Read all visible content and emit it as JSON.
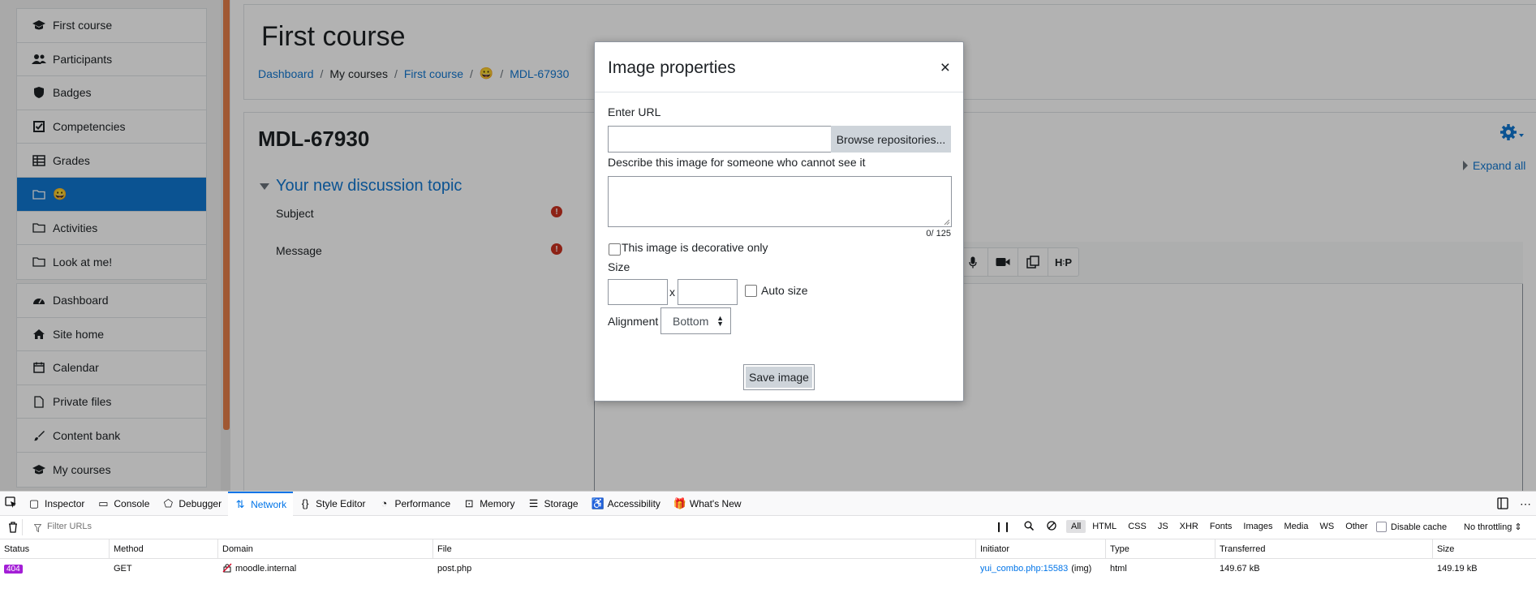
{
  "sidebar": {
    "group1": [
      {
        "label": "First course",
        "icon": "graduation-cap-icon"
      },
      {
        "label": "Participants",
        "icon": "users-icon"
      },
      {
        "label": "Badges",
        "icon": "shield-icon"
      },
      {
        "label": "Competencies",
        "icon": "check-square-icon"
      },
      {
        "label": "Grades",
        "icon": "table-icon"
      },
      {
        "label": "😀",
        "icon": "folder-icon",
        "active": true
      },
      {
        "label": "Activities",
        "icon": "folder-icon"
      },
      {
        "label": "Look at me!",
        "icon": "folder-icon"
      }
    ],
    "group2": [
      {
        "label": "Dashboard",
        "icon": "tachometer-icon"
      },
      {
        "label": "Site home",
        "icon": "home-icon"
      },
      {
        "label": "Calendar",
        "icon": "calendar-icon"
      },
      {
        "label": "Private files",
        "icon": "file-icon"
      },
      {
        "label": "Content bank",
        "icon": "paintbrush-icon"
      },
      {
        "label": "My courses",
        "icon": "graduation-cap-icon"
      }
    ]
  },
  "header": {
    "title": "First course",
    "breadcrumb": [
      "Dashboard",
      "My courses",
      "First course",
      "😀",
      "MDL-67930"
    ]
  },
  "main": {
    "forum_title": "MDL-67930",
    "topic_header": "Your new discussion topic",
    "subject_label": "Subject",
    "message_label": "Message",
    "expand_all": "Expand all",
    "required_glyph": "!",
    "toolbar_buttons": [
      {
        "icon": "microphone-icon",
        "glyph": "🎤"
      },
      {
        "icon": "video-icon",
        "glyph": "🎥"
      },
      {
        "icon": "copy-icon",
        "glyph": "⧉"
      },
      {
        "icon": "h5p-icon",
        "glyph": "H‑P"
      }
    ]
  },
  "dialog": {
    "title": "Image properties",
    "close": "×",
    "url_label": "Enter URL",
    "url_value": "",
    "browse_button": "Browse repositories...",
    "alt_label": "Describe this image for someone who cannot see it",
    "char_count": "0/ 125",
    "decorative_label": "This image is decorative only",
    "size_label": "Size",
    "size_x": "x",
    "autosize_label": "Auto size",
    "alignment_label": "Alignment",
    "alignment_value": "Bottom",
    "save_button": "Save image"
  },
  "devtools": {
    "tabs": [
      {
        "label": "Inspector",
        "icon": "inspector-icon",
        "glyph": "▢"
      },
      {
        "label": "Console",
        "icon": "console-icon",
        "glyph": "▭"
      },
      {
        "label": "Debugger",
        "icon": "debugger-icon",
        "glyph": "⬠"
      },
      {
        "label": "Network",
        "icon": "network-icon",
        "glyph": "⇅",
        "selected": true
      },
      {
        "label": "Style Editor",
        "icon": "style-editor-icon",
        "glyph": "{}"
      },
      {
        "label": "Performance",
        "icon": "performance-icon",
        "glyph": "◔"
      },
      {
        "label": "Memory",
        "icon": "memory-icon",
        "glyph": "⊡"
      },
      {
        "label": "Storage",
        "icon": "storage-icon",
        "glyph": "☰"
      },
      {
        "label": "Accessibility",
        "icon": "accessibility-icon",
        "glyph": "♿"
      },
      {
        "label": "What's New",
        "icon": "gift-icon",
        "glyph": "🎁"
      }
    ],
    "filter_placeholder": "Filter URLs",
    "filter_types": [
      "All",
      "HTML",
      "CSS",
      "JS",
      "XHR",
      "Fonts",
      "Images",
      "Media",
      "WS",
      "Other"
    ],
    "disable_cache": "Disable cache",
    "throttling": "No throttling ⇕",
    "columns": [
      "Status",
      "Method",
      "Domain",
      "File",
      "Initiator",
      "Type",
      "Transferred",
      "Size"
    ],
    "rows": [
      {
        "status": "404",
        "method": "GET",
        "domain": "moodle.internal",
        "file": "post.php",
        "initiator": "yui_combo.php:15583",
        "initiator_suffix": "(img)",
        "type": "html",
        "transferred": "149.67 kB",
        "size": "149.19 kB"
      }
    ]
  }
}
